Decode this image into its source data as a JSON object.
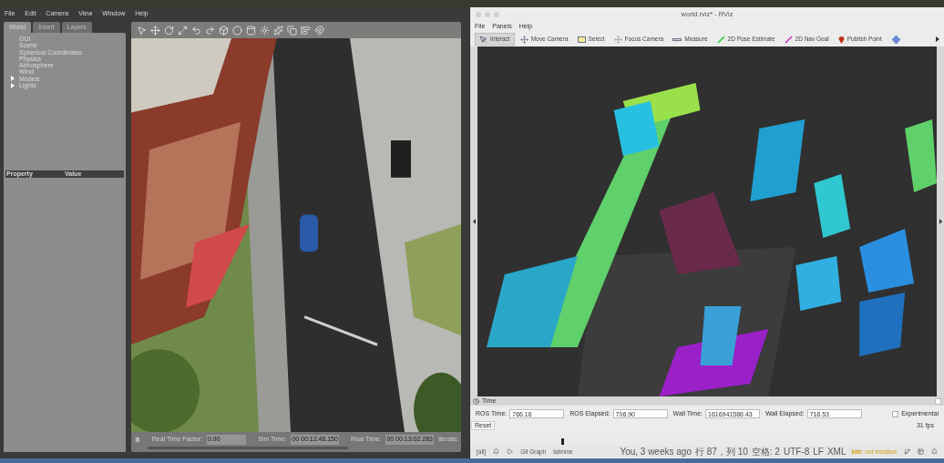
{
  "gazebo": {
    "menu": [
      "File",
      "Edit",
      "Camera",
      "View",
      "Window",
      "Help"
    ],
    "tabs": [
      {
        "label": "World",
        "selected": true
      },
      {
        "label": "Insert",
        "selected": false
      },
      {
        "label": "Layers",
        "selected": false
      }
    ],
    "tree": [
      {
        "label": "GUI",
        "kind": "leaf"
      },
      {
        "label": "Scene",
        "kind": "leaf"
      },
      {
        "label": "Spherical Coordinates",
        "kind": "leaf"
      },
      {
        "label": "Physics",
        "kind": "leaf"
      },
      {
        "label": "Atmosphere",
        "kind": "leaf"
      },
      {
        "label": "Wind",
        "kind": "leaf"
      },
      {
        "label": "Models",
        "kind": "group"
      },
      {
        "label": "Lights",
        "kind": "group"
      }
    ],
    "property_columns": [
      "Property",
      "Value"
    ],
    "paused": false,
    "stats": [
      {
        "label": "Real Time Factor:",
        "value": "0.90"
      },
      {
        "label": "Sim Time:",
        "value": "00 00:12:46.150"
      },
      {
        "label": "Real Time:",
        "value": "00 00:13:02.283"
      }
    ],
    "cut_label": "Iteratic"
  },
  "rviz": {
    "title": "world.rviz* - RViz",
    "menu": [
      "File",
      "Panels",
      "Help"
    ],
    "tools": [
      {
        "label": "Interact",
        "kind": "interact",
        "selected": true
      },
      {
        "label": "Move Camera",
        "kind": "move",
        "selected": false
      },
      {
        "label": "Select",
        "kind": "select",
        "selected": false
      },
      {
        "label": "Focus Camera",
        "kind": "focus",
        "selected": false
      },
      {
        "label": "Measure",
        "kind": "measure",
        "selected": false
      },
      {
        "label": "2D Pose Estimate",
        "kind": "pose",
        "selected": false
      },
      {
        "label": "2D Nav Goal",
        "kind": "goal",
        "selected": false
      },
      {
        "label": "Publish Point",
        "kind": "point",
        "selected": false
      }
    ],
    "time_panel": {
      "title": "Time",
      "fields": [
        {
          "label": "ROS Time:",
          "value": "766.16"
        },
        {
          "label": "ROS Elapsed:",
          "value": "706.90"
        },
        {
          "label": "Wall Time:",
          "value": "1616941586.43"
        },
        {
          "label": "Wall Elapsed:",
          "value": "718.53"
        }
      ],
      "experimental": {
        "label": "Experimental",
        "checked": false
      },
      "reset": "Reset",
      "fps": "31 fps"
    }
  },
  "status_bar": {
    "left": [
      "[all]",
      "Git Graph",
      "tabnine"
    ],
    "right": [
      "You, 3 weeks ago",
      "行 87，列 10",
      "空格: 2",
      "UTF-8",
      "LF",
      "XML"
    ],
    "kite": "**kite**: not installed"
  }
}
